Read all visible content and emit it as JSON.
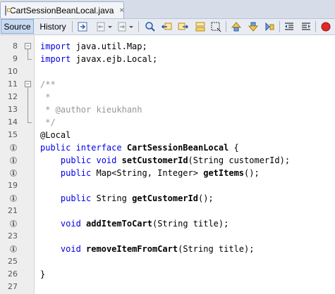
{
  "tab": {
    "title": "CartSessionBeanLocal.java",
    "close": "×"
  },
  "toolbar": {
    "source_label": "Source",
    "history_label": "History"
  },
  "colors": {
    "keyword": "#0000e6",
    "comment": "#969696",
    "gutter": "#eeeeee",
    "selected_tab": "#c7daf2"
  },
  "editor": {
    "lines": [
      {
        "num": "8",
        "fold": "minus",
        "impl": false,
        "segments": [
          {
            "t": "import",
            "c": "kw"
          },
          {
            "t": " java.util.Map;",
            "c": ""
          }
        ]
      },
      {
        "num": "9",
        "fold": "end",
        "impl": false,
        "segments": [
          {
            "t": "import",
            "c": "kw"
          },
          {
            "t": " javax.ejb.Local;",
            "c": ""
          }
        ]
      },
      {
        "num": "10",
        "fold": "",
        "impl": false,
        "segments": []
      },
      {
        "num": "11",
        "fold": "minus",
        "impl": false,
        "segments": [
          {
            "t": "/**",
            "c": "cm"
          }
        ]
      },
      {
        "num": "12",
        "fold": "bar",
        "impl": false,
        "segments": [
          {
            "t": " *",
            "c": "cm"
          }
        ]
      },
      {
        "num": "13",
        "fold": "bar",
        "impl": false,
        "segments": [
          {
            "t": " * @author kieukhanh",
            "c": "cm"
          }
        ]
      },
      {
        "num": "14",
        "fold": "end",
        "impl": false,
        "segments": [
          {
            "t": " */",
            "c": "cm"
          }
        ]
      },
      {
        "num": "15",
        "fold": "",
        "impl": false,
        "segments": [
          {
            "t": "@Local",
            "c": ""
          }
        ]
      },
      {
        "num": "",
        "fold": "",
        "impl": true,
        "segments": [
          {
            "t": "public interface",
            "c": "kw"
          },
          {
            "t": " ",
            "c": ""
          },
          {
            "t": "CartSessionBeanLocal",
            "c": "bold"
          },
          {
            "t": " {",
            "c": ""
          }
        ]
      },
      {
        "num": "",
        "fold": "",
        "impl": true,
        "segments": [
          {
            "t": "    ",
            "c": ""
          },
          {
            "t": "public void",
            "c": "kw"
          },
          {
            "t": " ",
            "c": ""
          },
          {
            "t": "setCustomerId",
            "c": "bold"
          },
          {
            "t": "(String customerId);",
            "c": ""
          }
        ]
      },
      {
        "num": "",
        "fold": "",
        "impl": true,
        "segments": [
          {
            "t": "    ",
            "c": ""
          },
          {
            "t": "public",
            "c": "kw"
          },
          {
            "t": " Map<String, Integer> ",
            "c": ""
          },
          {
            "t": "getItems",
            "c": "bold"
          },
          {
            "t": "();",
            "c": ""
          }
        ]
      },
      {
        "num": "19",
        "fold": "",
        "impl": false,
        "segments": []
      },
      {
        "num": "",
        "fold": "",
        "impl": true,
        "segments": [
          {
            "t": "    ",
            "c": ""
          },
          {
            "t": "public",
            "c": "kw"
          },
          {
            "t": " String ",
            "c": ""
          },
          {
            "t": "getCustomerId",
            "c": "bold"
          },
          {
            "t": "();",
            "c": ""
          }
        ]
      },
      {
        "num": "21",
        "fold": "",
        "impl": false,
        "segments": []
      },
      {
        "num": "",
        "fold": "",
        "impl": true,
        "segments": [
          {
            "t": "    ",
            "c": ""
          },
          {
            "t": "void",
            "c": "kw"
          },
          {
            "t": " ",
            "c": ""
          },
          {
            "t": "addItemToCart",
            "c": "bold"
          },
          {
            "t": "(String title);",
            "c": ""
          }
        ]
      },
      {
        "num": "23",
        "fold": "",
        "impl": false,
        "segments": []
      },
      {
        "num": "",
        "fold": "",
        "impl": true,
        "segments": [
          {
            "t": "    ",
            "c": ""
          },
          {
            "t": "void",
            "c": "kw"
          },
          {
            "t": " ",
            "c": ""
          },
          {
            "t": "removeItemFromCart",
            "c": "bold"
          },
          {
            "t": "(String title);",
            "c": ""
          }
        ]
      },
      {
        "num": "25",
        "fold": "",
        "impl": false,
        "segments": []
      },
      {
        "num": "26",
        "fold": "",
        "impl": false,
        "segments": [
          {
            "t": "}",
            "c": ""
          }
        ]
      },
      {
        "num": "27",
        "fold": "",
        "impl": false,
        "segments": []
      }
    ]
  }
}
